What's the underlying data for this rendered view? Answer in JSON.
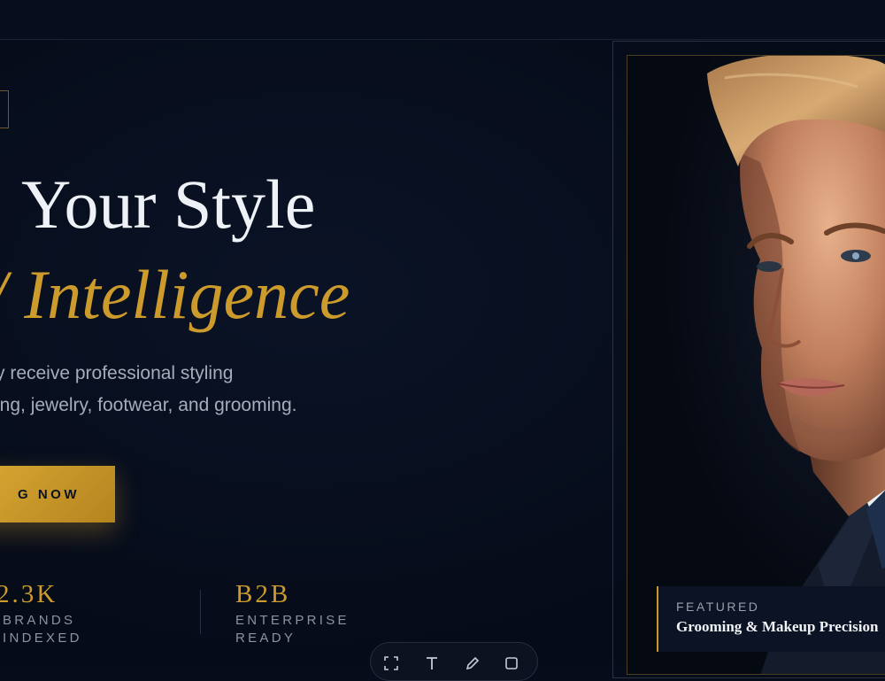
{
  "hero": {
    "headline_line1": "Your Style",
    "headline_line2": "/ Intelligence",
    "description_line1": "y receive professional styling",
    "description_line2": "ing, jewelry, footwear, and grooming.",
    "cta_label": "G NOW"
  },
  "stats": [
    {
      "value": "2.3K",
      "label_line1": "BRANDS",
      "label_line2": "INDEXED"
    },
    {
      "value": "B2B",
      "label_line1": "ENTERPRISE",
      "label_line2": "READY"
    }
  ],
  "featured": {
    "kicker": "FEATURED",
    "title": "Grooming & Makeup Precision"
  },
  "toolbar": {
    "icons": [
      "select-icon",
      "text-icon",
      "pen-icon",
      "shape-icon"
    ]
  },
  "colors": {
    "background": "#060c1a",
    "accent_gold": "#cc9b2c",
    "headline": "#eef1f6",
    "muted_text": "#a6adba"
  }
}
